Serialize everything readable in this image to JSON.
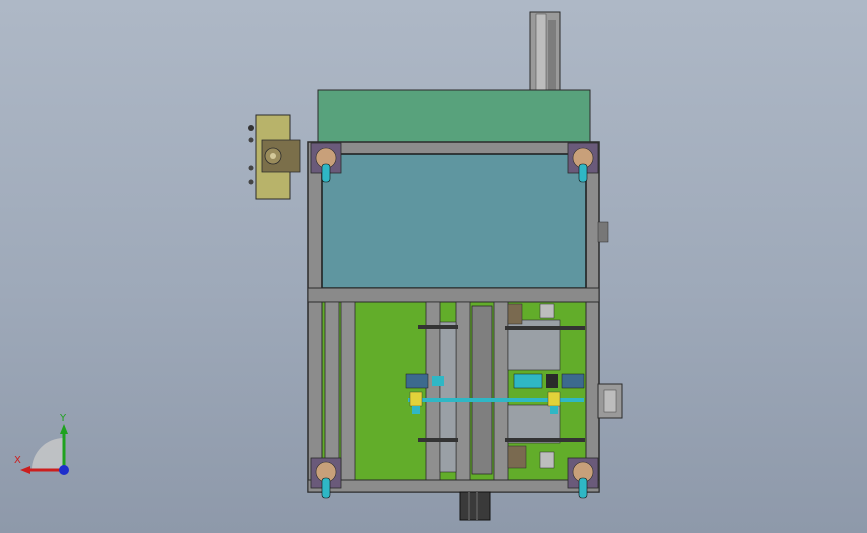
{
  "viewport": {
    "background_top": "#aeb8c6",
    "background_bottom": "#8e99aa"
  },
  "colors": {
    "frame_gray": "#8c8c8c",
    "frame_outline": "#2b2b2b",
    "panel_teal": "#5f96a0",
    "top_green": "#58a27c",
    "base_green": "#62ad2a",
    "plate_gray": "#9aa0a6",
    "motor_dark": "#3a3a3a",
    "control_box": "#b8b36a",
    "caster_purple": "#6a5a7a",
    "wheel_cyan": "#2fb7c5"
  },
  "triad": {
    "x_label": "X",
    "y_label": "Y",
    "x_color": "#cc1e1e",
    "y_color": "#1fa21f",
    "z_color": "#1e2ecc"
  },
  "icons": {
    "triad": "axis-triad-icon",
    "caster": "caster-wheel-icon",
    "motor": "motor-icon",
    "control_box": "control-box-icon"
  }
}
